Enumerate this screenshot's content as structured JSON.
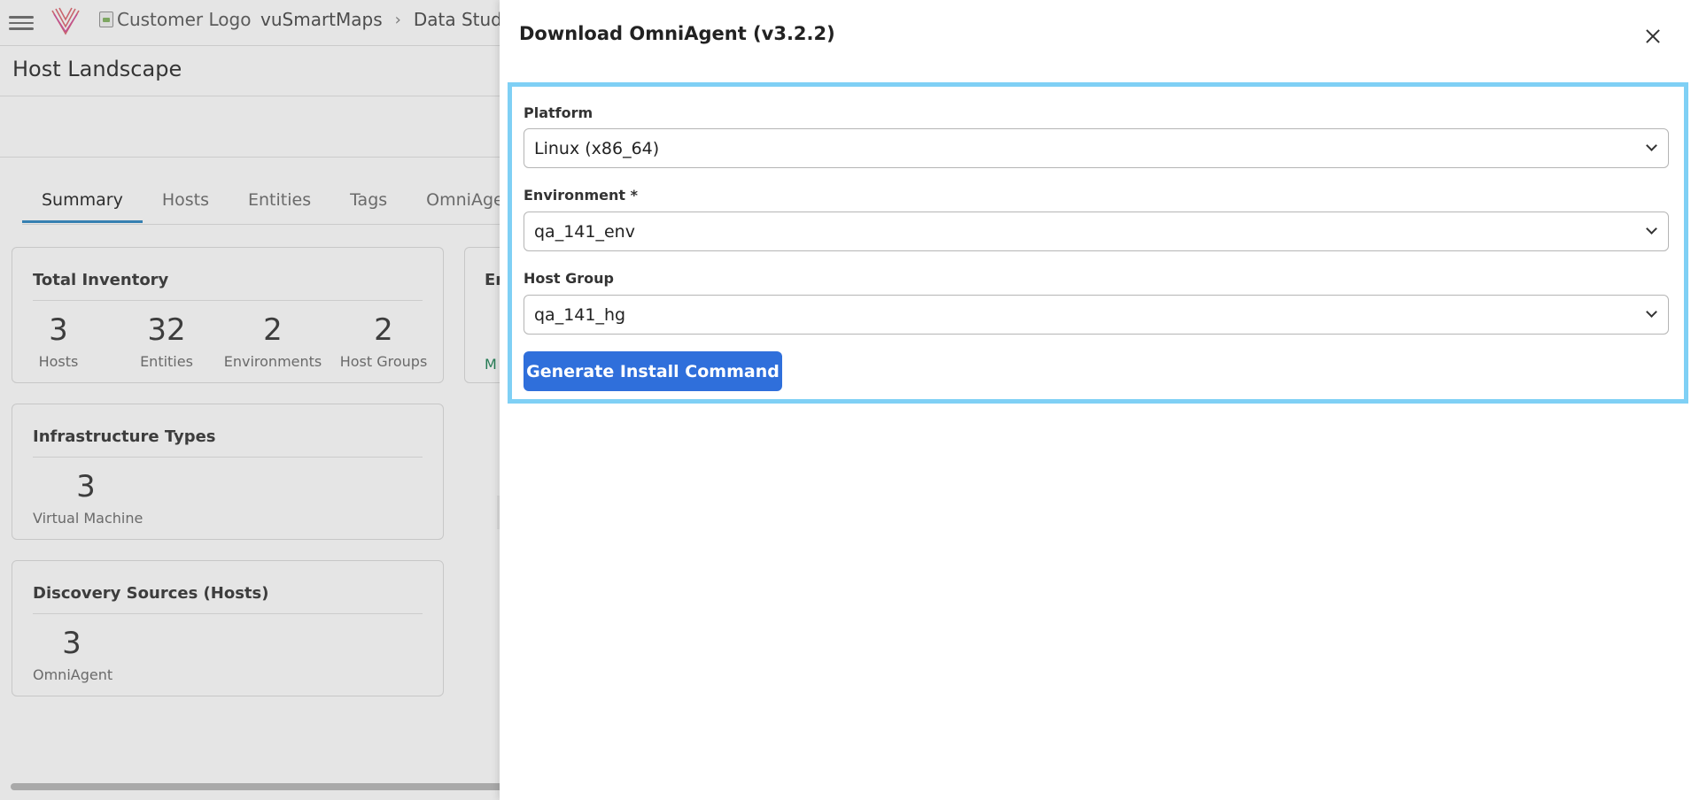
{
  "header": {
    "customer_logo_alt": "Customer Logo",
    "breadcrumb": [
      "vuSmartMaps",
      "Data Studio"
    ]
  },
  "page": {
    "title": "Host Landscape",
    "tabs": [
      "Summary",
      "Hosts",
      "Entities",
      "Tags",
      "OmniAgen"
    ],
    "active_tab": "Summary"
  },
  "cards": {
    "total_inventory": {
      "title": "Total Inventory",
      "stats": [
        {
          "value": "3",
          "label": "Hosts"
        },
        {
          "value": "32",
          "label": "Entities"
        },
        {
          "value": "2",
          "label": "Environments"
        },
        {
          "value": "2",
          "label": "Host Groups"
        }
      ]
    },
    "infrastructure_types": {
      "title": "Infrastructure Types",
      "stats": [
        {
          "value": "3",
          "label": "Virtual Machine"
        }
      ]
    },
    "discovery_sources": {
      "title": "Discovery Sources (Hosts)",
      "stats": [
        {
          "value": "3",
          "label": "OmniAgent"
        }
      ]
    },
    "partial_card": {
      "title": "En",
      "link": "M"
    }
  },
  "drawer": {
    "title": "Download OmniAgent (v3.2.2)",
    "fields": {
      "platform": {
        "label": "Platform",
        "value": "Linux (x86_64)"
      },
      "environment": {
        "label": "Environment *",
        "value": "qa_141_env"
      },
      "host_group": {
        "label": "Host Group",
        "value": "qa_141_hg"
      }
    },
    "generate_button": "Generate Install Command"
  },
  "colors": {
    "primary_button": "#2f6fdb",
    "highlight_border": "#7fd0f5",
    "active_tab_underline": "#3d8fc6"
  }
}
